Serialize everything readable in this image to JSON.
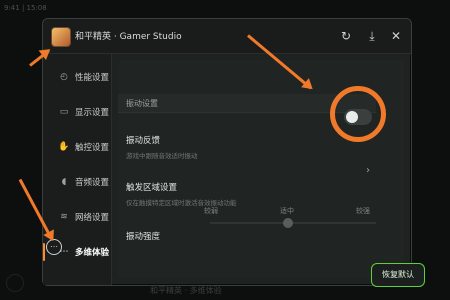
{
  "background": {
    "status_text": "9:41 | 15:08",
    "bottom_text": "和平精英 · 多维体验"
  },
  "window": {
    "title": "和平精英 · Gamer Studio",
    "buttons": {
      "refresh": "↻",
      "download": "⤓",
      "close": "✕"
    }
  },
  "sidebar": {
    "items": [
      {
        "label": "性能设置",
        "icon": "gauge-icon",
        "glyph": "◴"
      },
      {
        "label": "显示设置",
        "icon": "monitor-icon",
        "glyph": "▭"
      },
      {
        "label": "触控设置",
        "icon": "touch-icon",
        "glyph": "✋"
      },
      {
        "label": "音频设置",
        "icon": "speaker-icon",
        "glyph": "◖"
      },
      {
        "label": "网络设置",
        "icon": "wifi-icon",
        "glyph": "≋"
      },
      {
        "label": "多维体验",
        "icon": "more-icon",
        "glyph": "⋯"
      }
    ],
    "active_index": 5
  },
  "content": {
    "section_title": "振动设置",
    "vibration": {
      "title": "振动反馈",
      "desc": "游戏中跟随音效适时振动",
      "enabled": false
    },
    "trigger": {
      "title": "触发区域设置",
      "desc": "仅在触摸特定区域时激活音效振动功能"
    },
    "intensity": {
      "label": "振动强度",
      "min_label": "较弱",
      "mid_label": "适中",
      "max_label": "较强",
      "value": 0.5
    },
    "reset_button": "恢复默认"
  },
  "colors": {
    "accent_orange": "#f07a2a",
    "reset_green": "#5fcf3c"
  }
}
